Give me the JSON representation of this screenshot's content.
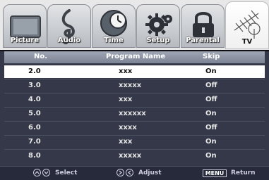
{
  "tabs": [
    {
      "label": "Picture",
      "icon": "picture-icon"
    },
    {
      "label": "Audio",
      "icon": "music-note-icon"
    },
    {
      "label": "Time",
      "icon": "clock-icon"
    },
    {
      "label": "Setup",
      "icon": "gear-icon"
    },
    {
      "label": "Parental",
      "icon": "lock-icon"
    },
    {
      "label": "TV",
      "icon": "tv-antenna-icon",
      "active": true
    }
  ],
  "table": {
    "headers": {
      "no": "No.",
      "name": "Program Name",
      "skip": "Skip"
    },
    "rows": [
      {
        "no": "2.0",
        "name": "xxx",
        "skip": "On",
        "selected": true
      },
      {
        "no": "3.0",
        "name": "xxxxx",
        "skip": "Off"
      },
      {
        "no": "4.0",
        "name": "xxx",
        "skip": "Off"
      },
      {
        "no": "5.0",
        "name": "xxxxxx",
        "skip": "On"
      },
      {
        "no": "6.0",
        "name": "xxxx",
        "skip": "Off"
      },
      {
        "no": "7.0",
        "name": "xxx",
        "skip": "On"
      },
      {
        "no": "8.0",
        "name": "xxxxx",
        "skip": "On"
      }
    ]
  },
  "footer": {
    "select": "Select",
    "adjust": "Adjust",
    "menu_key": "MENU",
    "return": "Return"
  },
  "colors": {
    "accent": "#ffffff",
    "header": "#8f96a5",
    "panel": "#343849"
  }
}
